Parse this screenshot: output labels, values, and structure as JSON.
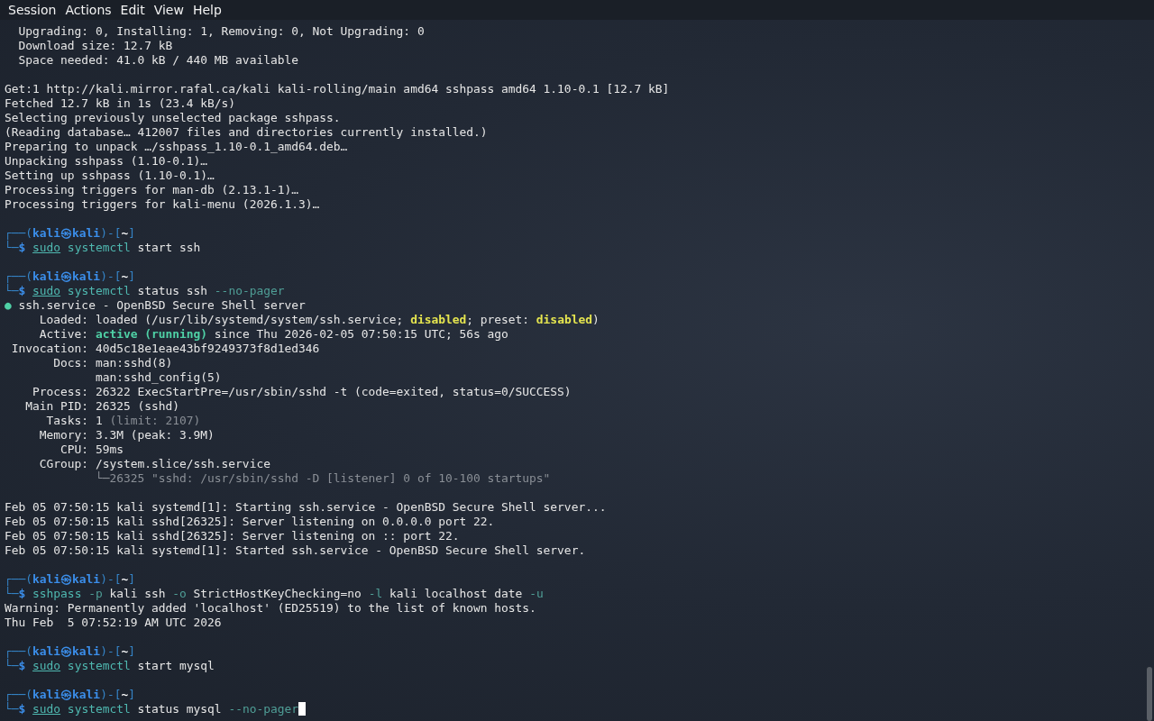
{
  "menu": [
    {
      "label": "Session"
    },
    {
      "label": "Actions"
    },
    {
      "label": "Edit"
    },
    {
      "label": "View"
    },
    {
      "label": "Help"
    }
  ],
  "blocks": [
    {
      "lines": [
        {
          "spans": [
            {
              "kind": "text",
              "text": "  Upgrading: 0, Installing: 1, Removing: 0, Not Upgrading: 0"
            }
          ]
        },
        {
          "spans": [
            {
              "kind": "text",
              "text": "  Download size: 12.7 kB"
            }
          ]
        },
        {
          "spans": [
            {
              "kind": "text",
              "text": "  Space needed: 41.0 kB / 440 MB available"
            }
          ]
        }
      ]
    },
    {
      "lines": [
        {
          "spans": [
            {
              "kind": "text",
              "text": "Get:1 http://kali.mirror.rafal.ca/kali kali-rolling/main amd64 sshpass amd64 1.10-0.1 [12.7 kB]"
            }
          ]
        },
        {
          "spans": [
            {
              "kind": "text",
              "text": "Fetched 12.7 kB in 1s (23.4 kB/s)"
            }
          ]
        },
        {
          "spans": [
            {
              "kind": "text",
              "text": "Selecting previously unselected package sshpass."
            }
          ]
        },
        {
          "spans": [
            {
              "kind": "text",
              "text": "(Reading database… 412007 files and directories currently installed.)"
            }
          ]
        },
        {
          "spans": [
            {
              "kind": "text",
              "text": "Preparing to unpack …/sshpass_1.10-0.1_amd64.deb…"
            }
          ]
        },
        {
          "spans": [
            {
              "kind": "text",
              "text": "Unpacking sshpass (1.10-0.1)…"
            }
          ]
        },
        {
          "spans": [
            {
              "kind": "text",
              "text": "Setting up sshpass (1.10-0.1)…"
            }
          ]
        },
        {
          "spans": [
            {
              "kind": "text",
              "text": "Processing triggers for man-db (2.13.1-1)…"
            }
          ]
        },
        {
          "spans": [
            {
              "kind": "text",
              "text": "Processing triggers for kali-menu (2026.1.3)…"
            }
          ]
        }
      ]
    },
    {
      "lines": [
        {
          "spans": [
            {
              "kind": "frame",
              "text": "┌──("
            },
            {
              "kind": "user",
              "text": "kali㉿kali"
            },
            {
              "kind": "frame",
              "text": ")-["
            },
            {
              "kind": "path",
              "text": "~"
            },
            {
              "kind": "frame",
              "text": "]"
            }
          ]
        },
        {
          "spans": [
            {
              "kind": "frame",
              "text": "└─"
            },
            {
              "kind": "dollar",
              "text": "$ "
            },
            {
              "kind": "sudo",
              "text": "sudo"
            },
            {
              "kind": "cmd",
              "text": " systemctl"
            },
            {
              "kind": "text",
              "text": " start ssh"
            }
          ]
        }
      ]
    },
    {
      "lines": [
        {
          "spans": [
            {
              "kind": "frame",
              "text": "┌──("
            },
            {
              "kind": "user",
              "text": "kali㉿kali"
            },
            {
              "kind": "frame",
              "text": ")-["
            },
            {
              "kind": "path",
              "text": "~"
            },
            {
              "kind": "frame",
              "text": "]"
            }
          ]
        },
        {
          "spans": [
            {
              "kind": "frame",
              "text": "└─"
            },
            {
              "kind": "dollar",
              "text": "$ "
            },
            {
              "kind": "sudo",
              "text": "sudo"
            },
            {
              "kind": "cmd",
              "text": " systemctl"
            },
            {
              "kind": "text",
              "text": " status ssh "
            },
            {
              "kind": "flag",
              "text": "--no-pager"
            }
          ]
        },
        {
          "spans": [
            {
              "kind": "bullet",
              "text": "●"
            },
            {
              "kind": "text",
              "text": " ssh.service - OpenBSD Secure Shell server"
            }
          ]
        },
        {
          "spans": [
            {
              "kind": "text",
              "text": "     Loaded: loaded (/usr/lib/systemd/system/ssh.service; "
            },
            {
              "kind": "warn",
              "text": "disabled"
            },
            {
              "kind": "text",
              "text": "; preset: "
            },
            {
              "kind": "warn",
              "text": "disabled"
            },
            {
              "kind": "text",
              "text": ")"
            }
          ]
        },
        {
          "spans": [
            {
              "kind": "text",
              "text": "     Active: "
            },
            {
              "kind": "ok",
              "text": "active (running)"
            },
            {
              "kind": "text",
              "text": " since Thu 2026-02-05 07:50:15 UTC; 56s ago"
            }
          ]
        },
        {
          "spans": [
            {
              "kind": "text",
              "text": " Invocation: 40d5c18e1eae43bf9249373f8d1ed346"
            }
          ]
        },
        {
          "spans": [
            {
              "kind": "text",
              "text": "       Docs: man:sshd(8)"
            }
          ]
        },
        {
          "spans": [
            {
              "kind": "text",
              "text": "             man:sshd_config(5)"
            }
          ]
        },
        {
          "spans": [
            {
              "kind": "text",
              "text": "    Process: 26322 ExecStartPre=/usr/sbin/sshd -t (code=exited, status=0/SUCCESS)"
            }
          ]
        },
        {
          "spans": [
            {
              "kind": "text",
              "text": "   Main PID: 26325 (sshd)"
            }
          ]
        },
        {
          "spans": [
            {
              "kind": "text",
              "text": "      Tasks: 1 "
            },
            {
              "kind": "dim",
              "text": "(limit: 2107)"
            }
          ]
        },
        {
          "spans": [
            {
              "kind": "text",
              "text": "     Memory: 3.3M (peak: 3.9M)"
            }
          ]
        },
        {
          "spans": [
            {
              "kind": "text",
              "text": "        CPU: 59ms"
            }
          ]
        },
        {
          "spans": [
            {
              "kind": "text",
              "text": "     CGroup: /system.slice/ssh.service"
            }
          ]
        },
        {
          "spans": [
            {
              "kind": "dim",
              "text": "             └─26325 \"sshd: /usr/sbin/sshd -D [listener] 0 of 10-100 startups\""
            }
          ]
        }
      ]
    },
    {
      "lines": [
        {
          "spans": [
            {
              "kind": "text",
              "text": "Feb 05 07:50:15 kali systemd[1]: Starting ssh.service - OpenBSD Secure Shell server..."
            }
          ]
        },
        {
          "spans": [
            {
              "kind": "text",
              "text": "Feb 05 07:50:15 kali sshd[26325]: Server listening on 0.0.0.0 port 22."
            }
          ]
        },
        {
          "spans": [
            {
              "kind": "text",
              "text": "Feb 05 07:50:15 kali sshd[26325]: Server listening on :: port 22."
            }
          ]
        },
        {
          "spans": [
            {
              "kind": "text",
              "text": "Feb 05 07:50:15 kali systemd[1]: Started ssh.service - OpenBSD Secure Shell server."
            }
          ]
        }
      ]
    },
    {
      "lines": [
        {
          "spans": [
            {
              "kind": "frame",
              "text": "┌──("
            },
            {
              "kind": "user",
              "text": "kali㉿kali"
            },
            {
              "kind": "frame",
              "text": ")-["
            },
            {
              "kind": "path",
              "text": "~"
            },
            {
              "kind": "frame",
              "text": "]"
            }
          ]
        },
        {
          "spans": [
            {
              "kind": "frame",
              "text": "└─"
            },
            {
              "kind": "dollar",
              "text": "$ "
            },
            {
              "kind": "cmd",
              "text": "sshpass "
            },
            {
              "kind": "flag",
              "text": "-p"
            },
            {
              "kind": "text",
              "text": " kali ssh "
            },
            {
              "kind": "flag",
              "text": "-o"
            },
            {
              "kind": "text",
              "text": " StrictHostKeyChecking=no "
            },
            {
              "kind": "flag",
              "text": "-l"
            },
            {
              "kind": "text",
              "text": " kali localhost date "
            },
            {
              "kind": "flag",
              "text": "-u"
            }
          ]
        },
        {
          "spans": [
            {
              "kind": "text",
              "text": "Warning: Permanently added 'localhost' (ED25519) to the list of known hosts."
            }
          ]
        },
        {
          "spans": [
            {
              "kind": "text",
              "text": "Thu Feb  5 07:52:19 AM UTC 2026"
            }
          ]
        }
      ]
    },
    {
      "lines": [
        {
          "spans": [
            {
              "kind": "frame",
              "text": "┌──("
            },
            {
              "kind": "user",
              "text": "kali㉿kali"
            },
            {
              "kind": "frame",
              "text": ")-["
            },
            {
              "kind": "path",
              "text": "~"
            },
            {
              "kind": "frame",
              "text": "]"
            }
          ]
        },
        {
          "spans": [
            {
              "kind": "frame",
              "text": "└─"
            },
            {
              "kind": "dollar",
              "text": "$ "
            },
            {
              "kind": "sudo",
              "text": "sudo"
            },
            {
              "kind": "cmd",
              "text": " systemctl"
            },
            {
              "kind": "text",
              "text": " start mysql"
            }
          ]
        }
      ]
    },
    {
      "lines": [
        {
          "spans": [
            {
              "kind": "frame",
              "text": "┌──("
            },
            {
              "kind": "user",
              "text": "kali㉿kali"
            },
            {
              "kind": "frame",
              "text": ")-["
            },
            {
              "kind": "path",
              "text": "~"
            },
            {
              "kind": "frame",
              "text": "]"
            }
          ]
        },
        {
          "spans": [
            {
              "kind": "frame",
              "text": "└─"
            },
            {
              "kind": "dollar",
              "text": "$ "
            },
            {
              "kind": "sudo",
              "text": "sudo"
            },
            {
              "kind": "cmd",
              "text": " systemctl"
            },
            {
              "kind": "text",
              "text": " status mysql "
            },
            {
              "kind": "flag",
              "text": "--no-pager"
            }
          ],
          "cursor": true
        }
      ]
    }
  ]
}
